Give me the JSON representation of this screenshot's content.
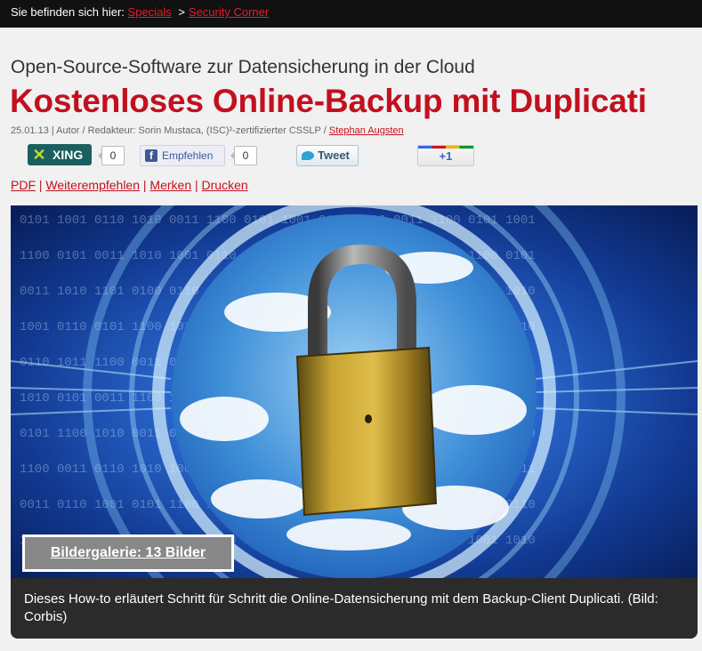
{
  "breadcrumb": {
    "prefix": "Sie befinden sich hier:",
    "items": [
      "Specials",
      "Security Corner"
    ],
    "separator": ">"
  },
  "article": {
    "subtitle": "Open-Source-Software zur Datensicherung in der Cloud",
    "title": "Kostenloses Online-Backup mit Duplicati",
    "meta_text": "25.01.13 | Autor / Redakteur: Sorin Mustaca, (ISC)²-zertifizierter CSSLP /",
    "meta_author_link": "Stephan Augsten"
  },
  "share": {
    "xing_label": "XING",
    "xing_count": "0",
    "facebook_label": "Empfehlen",
    "facebook_count": "0",
    "tweet_label": "Tweet",
    "gplus_label": "+1"
  },
  "tools": {
    "pdf": "PDF",
    "recommend": "Weiterempfehlen",
    "bookmark": "Merken",
    "print": "Drucken"
  },
  "hero": {
    "gallery_button": "Bildergalerie: 13 Bilder",
    "caption": "Dieses How-to erläutert Schritt für Schritt die Online-Datensicherung mit dem Backup-Client Duplicati. (Bild: Corbis)"
  },
  "colors": {
    "accent": "#c3101e",
    "topbar": "#111111",
    "xing": "#1b5f5f"
  }
}
